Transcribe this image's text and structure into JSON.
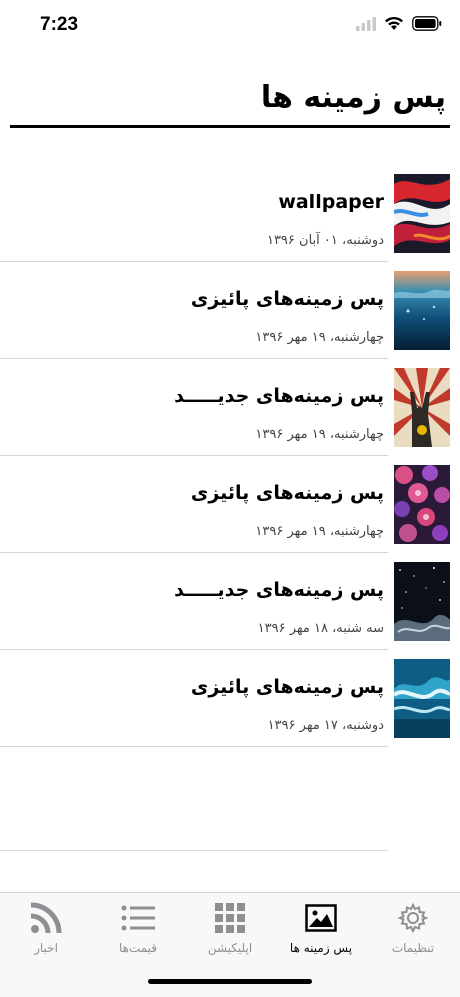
{
  "status": {
    "time": "7:23"
  },
  "page": {
    "title": "پس زمینه ها"
  },
  "items": [
    {
      "title": "wallpaper",
      "date": "دوشنبه، ۰۱ آبان ۱۳۹۶",
      "thumb_icon": "abstract-art-thumb"
    },
    {
      "title": "پس زمینه‌های پائیزی",
      "date": "چهارشنبه، ۱۹ مهر ۱۳۹۶",
      "thumb_icon": "ocean-thumb"
    },
    {
      "title": "پس زمینه‌های جدیـــــد",
      "date": "چهارشنبه، ۱۹ مهر ۱۳۹۶",
      "thumb_icon": "rock-hand-thumb"
    },
    {
      "title": "پس زمینه‌های پائیزی",
      "date": "چهارشنبه، ۱۹ مهر ۱۳۹۶",
      "thumb_icon": "flowers-thumb"
    },
    {
      "title": "پس زمینه‌های جدیـــــد",
      "date": "سه شنبه، ۱۸ مهر ۱۳۹۶",
      "thumb_icon": "space-thumb"
    },
    {
      "title": "پس زمینه‌های پائیزی",
      "date": "دوشنبه، ۱۷ مهر ۱۳۹۶",
      "thumb_icon": "wave-thumb"
    }
  ],
  "tabs": [
    {
      "label": "تنظیمات",
      "icon": "gear-icon",
      "active": false
    },
    {
      "label": "پس زمینه ها",
      "icon": "image-icon",
      "active": true
    },
    {
      "label": "اپلیکیشن",
      "icon": "grid-icon",
      "active": false
    },
    {
      "label": "قیمت‌ها",
      "icon": "list-icon",
      "active": false
    },
    {
      "label": "اخبار",
      "icon": "rss-icon",
      "active": false
    }
  ],
  "colors": {
    "active": "#000000",
    "inactive": "#8e8e93"
  }
}
